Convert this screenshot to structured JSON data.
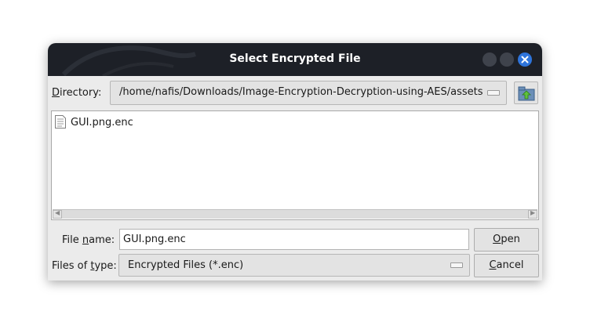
{
  "window": {
    "title": "Select Encrypted File"
  },
  "directory": {
    "label_accel": "D",
    "label_rest": "irectory:",
    "path": "/home/nafis/Downloads/Image-Encryption-Decryption-using-AES/assets"
  },
  "file_list": {
    "items": [
      {
        "name": "GUI.png.enc",
        "icon": "document-icon"
      }
    ]
  },
  "filename": {
    "label_before": "File ",
    "label_accel": "n",
    "label_after": "ame:",
    "value": "GUI.png.enc"
  },
  "filetype": {
    "label_before": "Files of ",
    "label_accel": "t",
    "label_after": "ype:",
    "value": "Encrypted Files (*.enc)"
  },
  "buttons": {
    "open_accel": "O",
    "open_rest": "pen",
    "cancel_accel": "C",
    "cancel_rest": "ancel"
  },
  "colors": {
    "titlebar": "#1d2027",
    "close_button": "#2e74db",
    "dialog_background": "#ebebeb"
  }
}
